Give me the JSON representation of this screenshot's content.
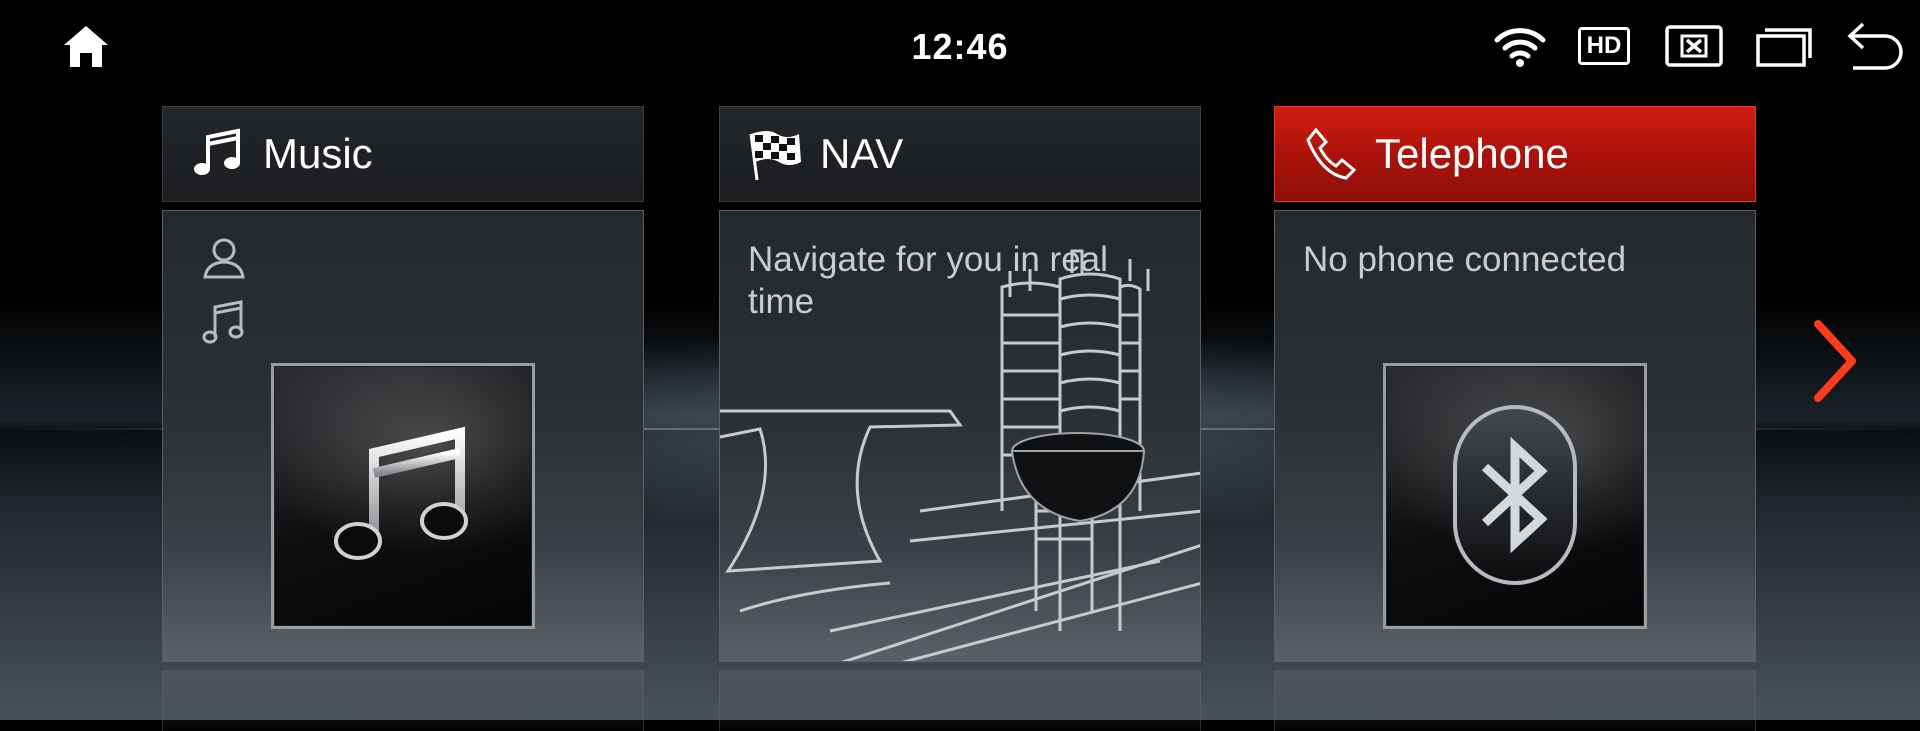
{
  "status_bar": {
    "time": "12:46",
    "hd_label": "HD",
    "icons": [
      "home-icon",
      "wifi-icon",
      "hd-icon",
      "close-box-icon",
      "windows-icon",
      "back-icon"
    ]
  },
  "cards": {
    "music": {
      "title": "Music",
      "icon": "music-note-icon",
      "artist": "",
      "track": "",
      "tile_icon": "large-music-note-icon"
    },
    "nav": {
      "title": "NAV",
      "icon": "checkered-flag-icon",
      "description": "Navigate for you in real time"
    },
    "telephone": {
      "title": "Telephone",
      "icon": "phone-handset-icon",
      "status": "No phone connected",
      "tile_icon": "bluetooth-icon",
      "active": true
    }
  },
  "pager": {
    "next_icon": "chevron-right-icon"
  },
  "colors": {
    "accent_red": "#c0180f",
    "arrow_red": "#ff3b1f",
    "text_muted": "#c9ccd0",
    "background": "#000000"
  }
}
